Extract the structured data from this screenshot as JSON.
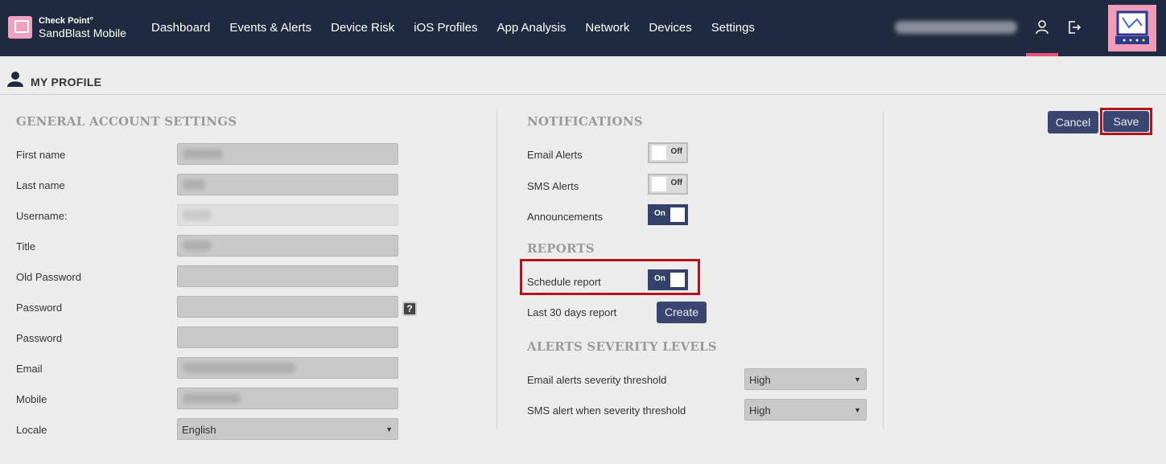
{
  "brand": {
    "line1": "Check Point°",
    "line2": "SandBlast Mobile"
  },
  "nav": [
    "Dashboard",
    "Events & Alerts",
    "Device Risk",
    "iOS Profiles",
    "App Analysis",
    "Network",
    "Devices",
    "Settings"
  ],
  "page": {
    "title": "MY PROFILE"
  },
  "general": {
    "heading": "GENERAL ACCOUNT SETTINGS",
    "labels": {
      "first_name": "First name",
      "last_name": "Last name",
      "username": "Username:",
      "title": "Title",
      "old_password": "Old Password",
      "password": "Password",
      "password_confirm": "Password",
      "email": "Email",
      "mobile": "Mobile",
      "locale": "Locale"
    },
    "locale_value": "English",
    "help_glyph": "?"
  },
  "notifications": {
    "heading": "NOTIFICATIONS",
    "email_alerts": {
      "label": "Email Alerts",
      "state": "Off"
    },
    "sms_alerts": {
      "label": "SMS Alerts",
      "state": "Off"
    },
    "announcements": {
      "label": "Announcements",
      "state": "On"
    }
  },
  "reports": {
    "heading": "REPORTS",
    "schedule": {
      "label": "Schedule report",
      "state": "On"
    },
    "last30": {
      "label": "Last 30 days report",
      "button": "Create"
    }
  },
  "severity": {
    "heading": "ALERTS SEVERITY LEVELS",
    "email_threshold": {
      "label": "Email alerts severity threshold",
      "value": "High"
    },
    "sms_threshold": {
      "label": "SMS alert when severity threshold",
      "value": "High"
    }
  },
  "actions": {
    "cancel": "Cancel",
    "save": "Save"
  },
  "colors": {
    "topbar": "#1f2a40",
    "accent": "#3b4670",
    "active_tab": "#e8537a",
    "highlight": "#b5121b"
  },
  "icons": {
    "user": "user-icon",
    "logout": "logout-icon",
    "profile": "profile-icon"
  }
}
